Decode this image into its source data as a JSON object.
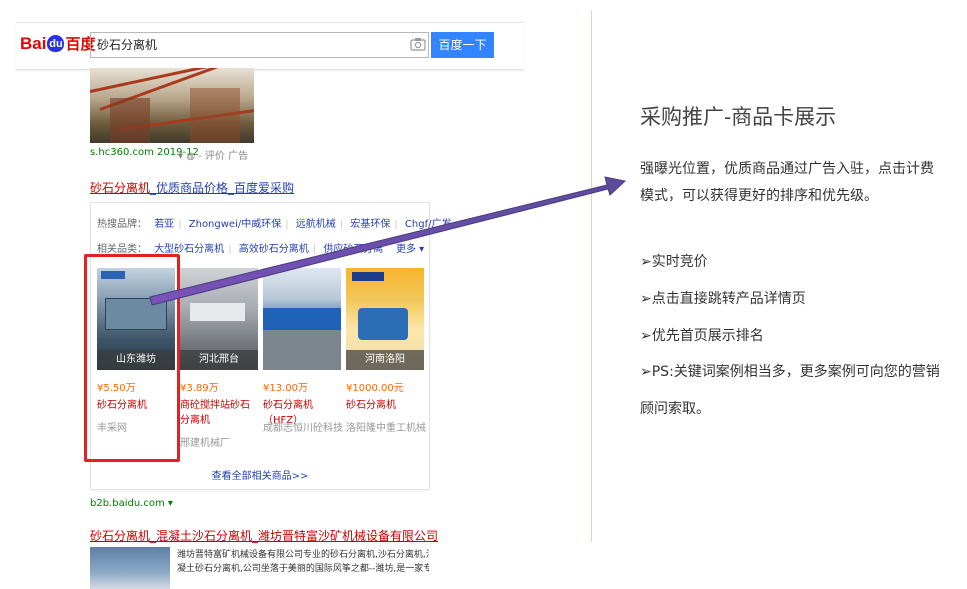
{
  "search": {
    "logo_bai": "Bai",
    "logo_du": "du",
    "logo_cn": "百度",
    "query": "砂石分离机",
    "button_label": "百度一下"
  },
  "result1": {
    "url": "s.hc360.com  2019-12",
    "meta": "▾ ◍ - 评价  广告"
  },
  "result2": {
    "title_red": "砂石分离机",
    "title_rest": "_优质商品价格_百度爱采购",
    "hot_brands_label": "热搜品牌：",
    "hot_brands": [
      "若亚",
      "Zhongwei/中威环保",
      "远航机械",
      "宏基环保",
      "Chgf/广发"
    ],
    "related_label": "相关品类：",
    "related": [
      "大型砂石分离机",
      "高效砂石分离机",
      "供应砂石分离"
    ],
    "more": "更多",
    "products": [
      {
        "location": "山东潍坊",
        "price": "¥5.50万",
        "name": "砂石分离机",
        "seller": "丰采网"
      },
      {
        "location": "河北邢台",
        "price": "¥3.89万",
        "name": "商砼搅拌站砂石分离机",
        "seller": "邢建机械厂"
      },
      {
        "location": "",
        "price": "¥13.00万",
        "name": "砂石分离机（HFZ）",
        "seller": "成都志恒川砼科技..."
      },
      {
        "location": "河南洛阳",
        "price": "¥1000.00元",
        "name": "砂石分离机",
        "seller": "洛阳隆中重工机械..."
      }
    ],
    "view_all": "查看全部相关商品>>",
    "url": "b2b.baidu.com ▾"
  },
  "result3": {
    "title": "砂石分离机_混凝土沙石分离机_潍坊晋特富沙矿机械设备有限公司",
    "desc_line1": "潍坊晋特富矿机械设备有限公司专业的砂石分离机,沙石分离机,混",
    "desc_line2": "凝土砂石分离机,公司坐落于美丽的国际风筝之都--潍坊,是一家专业从"
  },
  "panel": {
    "title": "采购推广-商品卡展示",
    "intro": "强曝光位置，优质商品通过广告入驻，点击计费模式，可以获得更好的排序和优先级。",
    "features": [
      "实时竞价",
      "点击直接跳转产品详情页",
      "优先首页展示排名",
      "PS:关键词案例相当多，更多案例可向您的营销顾问索取。"
    ],
    "bullet": "➢"
  },
  "colors": {
    "arrow": "#6b4fa8",
    "highlight": "#e12222",
    "baidu_blue": "#3385ff"
  }
}
